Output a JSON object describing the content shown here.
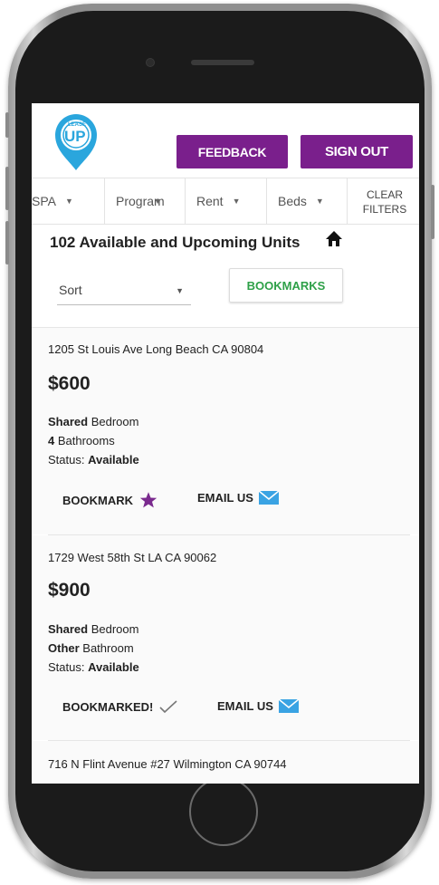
{
  "app": {
    "logo_text_top": "LEASE",
    "logo_text_main": "UP",
    "accent_color": "#7a1f8c",
    "logo_color": "#2aa6dd"
  },
  "header": {
    "feedback_label": "FEEDBACK",
    "signout_label": "SIGN OUT"
  },
  "filters": {
    "items": [
      {
        "label": "SPA"
      },
      {
        "label": "Program"
      },
      {
        "label": "Rent"
      },
      {
        "label": "Beds"
      }
    ],
    "clear_label_line1": "CLEAR",
    "clear_label_line2": "FILTERS"
  },
  "main": {
    "heading": "102 Available and Upcoming Units",
    "sort_label": "Sort",
    "bookmarks_label": "BOOKMARKS"
  },
  "listings": [
    {
      "address": "1205 St Louis Ave Long Beach CA 90804",
      "price": "$600",
      "bedroom_bold": "Shared",
      "bedroom_rest": " Bedroom",
      "bathroom_bold": "4",
      "bathroom_rest": " Bathrooms",
      "status_prefix": "Status: ",
      "status_value": "Available",
      "bookmark_label": "BOOKMARK",
      "email_label": "EMAIL US"
    },
    {
      "address": "1729 West 58th St LA CA 90062",
      "price": "$900",
      "bedroom_bold": "Shared",
      "bedroom_rest": " Bedroom",
      "bathroom_bold": "Other",
      "bathroom_rest": " Bathroom",
      "status_prefix": "Status: ",
      "status_value": "Available",
      "bookmark_label": "BOOKMARKED!",
      "email_label": "EMAIL US"
    },
    {
      "address": "716 N Flint Avenue #27 Wilmington CA 90744"
    }
  ]
}
